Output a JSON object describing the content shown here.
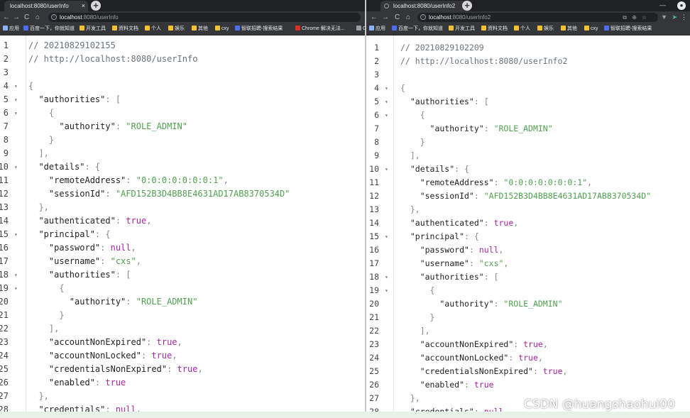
{
  "left": {
    "tab": {
      "title": "localhost:8080/userInfo",
      "close": "×"
    },
    "newtab": "+",
    "nav": {
      "back": "←",
      "forward": "→",
      "reload": "C",
      "home": "⌂"
    },
    "url": {
      "host": "localhost",
      "path": ":8080/userInfo"
    },
    "bookmarks": [
      {
        "label": "应用",
        "icon": "grid"
      },
      {
        "label": "百度一下，你就知道",
        "icon": "blue"
      },
      {
        "label": "开发工具",
        "icon": "folder"
      },
      {
        "label": "资料文档",
        "icon": "folder"
      },
      {
        "label": "个人",
        "icon": "folder"
      },
      {
        "label": "娱乐",
        "icon": "folder"
      },
      {
        "label": "其他",
        "icon": "folder"
      },
      {
        "label": "cxy",
        "icon": "folder"
      },
      {
        "label": "智联招聘-搜索结果",
        "icon": "blue"
      },
      {
        "label": "Chrome 解决无法...",
        "icon": "red"
      },
      {
        "label": "Oper",
        "icon": "gray"
      }
    ],
    "lines": [
      {
        "n": "1",
        "f": "",
        "t": [
          [
            "c",
            "// 20210829102155"
          ]
        ]
      },
      {
        "n": "2",
        "f": "",
        "t": [
          [
            "c",
            "// http://localhost:8080/userInfo"
          ]
        ]
      },
      {
        "n": "3",
        "f": "",
        "t": []
      },
      {
        "n": "4",
        "f": "▾",
        "t": [
          [
            "p",
            "{"
          ]
        ]
      },
      {
        "n": "5",
        "f": "▾",
        "t": [
          [
            "k",
            "  \"authorities\""
          ],
          [
            "p",
            ": ["
          ]
        ]
      },
      {
        "n": "6",
        "f": "▾",
        "t": [
          [
            "p",
            "    {"
          ]
        ]
      },
      {
        "n": "7",
        "f": "",
        "t": [
          [
            "k",
            "      \"authority\""
          ],
          [
            "p",
            ": "
          ],
          [
            "s",
            "\"ROLE_ADMIN\""
          ]
        ]
      },
      {
        "n": "8",
        "f": "",
        "t": [
          [
            "p",
            "    }"
          ]
        ]
      },
      {
        "n": "9",
        "f": "",
        "t": [
          [
            "p",
            "  ],"
          ]
        ]
      },
      {
        "n": "10",
        "f": "▾",
        "t": [
          [
            "k",
            "  \"details\""
          ],
          [
            "p",
            ": {"
          ]
        ]
      },
      {
        "n": "11",
        "f": "",
        "t": [
          [
            "k",
            "    \"remoteAddress\""
          ],
          [
            "p",
            ": "
          ],
          [
            "s",
            "\"0:0:0:0:0:0:0:1\""
          ],
          [
            "p",
            ","
          ]
        ]
      },
      {
        "n": "12",
        "f": "",
        "t": [
          [
            "k",
            "    \"sessionId\""
          ],
          [
            "p",
            ": "
          ],
          [
            "s",
            "\"AFD152B3D4BB8E4631AD17AB8370534D\""
          ]
        ]
      },
      {
        "n": "13",
        "f": "",
        "t": [
          [
            "p",
            "  },"
          ]
        ]
      },
      {
        "n": "14",
        "f": "",
        "t": [
          [
            "k",
            "  \"authenticated\""
          ],
          [
            "p",
            ": "
          ],
          [
            "b",
            "true"
          ],
          [
            "p",
            ","
          ]
        ]
      },
      {
        "n": "15",
        "f": "▾",
        "t": [
          [
            "k",
            "  \"principal\""
          ],
          [
            "p",
            ": {"
          ]
        ]
      },
      {
        "n": "16",
        "f": "",
        "t": [
          [
            "k",
            "    \"password\""
          ],
          [
            "p",
            ": "
          ],
          [
            "b",
            "null"
          ],
          [
            "p",
            ","
          ]
        ]
      },
      {
        "n": "17",
        "f": "",
        "t": [
          [
            "k",
            "    \"username\""
          ],
          [
            "p",
            ": "
          ],
          [
            "s",
            "\"cxs\""
          ],
          [
            "p",
            ","
          ]
        ]
      },
      {
        "n": "18",
        "f": "▾",
        "t": [
          [
            "k",
            "    \"authorities\""
          ],
          [
            "p",
            ": ["
          ]
        ]
      },
      {
        "n": "19",
        "f": "▾",
        "t": [
          [
            "p",
            "      {"
          ]
        ]
      },
      {
        "n": "20",
        "f": "",
        "t": [
          [
            "k",
            "        \"authority\""
          ],
          [
            "p",
            ": "
          ],
          [
            "s",
            "\"ROLE_ADMIN\""
          ]
        ]
      },
      {
        "n": "21",
        "f": "",
        "t": [
          [
            "p",
            "      }"
          ]
        ]
      },
      {
        "n": "22",
        "f": "",
        "t": [
          [
            "p",
            "    ],"
          ]
        ]
      },
      {
        "n": "23",
        "f": "",
        "t": [
          [
            "k",
            "    \"accountNonExpired\""
          ],
          [
            "p",
            ": "
          ],
          [
            "b",
            "true"
          ],
          [
            "p",
            ","
          ]
        ]
      },
      {
        "n": "24",
        "f": "",
        "t": [
          [
            "k",
            "    \"accountNonLocked\""
          ],
          [
            "p",
            ": "
          ],
          [
            "b",
            "true"
          ],
          [
            "p",
            ","
          ]
        ]
      },
      {
        "n": "25",
        "f": "",
        "t": [
          [
            "k",
            "    \"credentialsNonExpired\""
          ],
          [
            "p",
            ": "
          ],
          [
            "b",
            "true"
          ],
          [
            "p",
            ","
          ]
        ]
      },
      {
        "n": "26",
        "f": "",
        "t": [
          [
            "k",
            "    \"enabled\""
          ],
          [
            "p",
            ": "
          ],
          [
            "b",
            "true"
          ]
        ]
      },
      {
        "n": "27",
        "f": "",
        "t": [
          [
            "p",
            "  },"
          ]
        ]
      },
      {
        "n": "28",
        "f": "",
        "t": [
          [
            "k",
            "  \"credentials\""
          ],
          [
            "p",
            ": "
          ],
          [
            "b",
            "null"
          ],
          [
            "p",
            ","
          ]
        ]
      }
    ]
  },
  "right": {
    "tab": {
      "title": "localhost:8080/userInfo2",
      "close": "×"
    },
    "newtab": "+",
    "nav": {
      "back": "←",
      "forward": "→",
      "reload": "C",
      "home": "⌂"
    },
    "url": {
      "host": "localhost",
      "path": ":8080/userInfo2"
    },
    "bookmarks": [
      {
        "label": "应用",
        "icon": "grid"
      },
      {
        "label": "百度一下，你就知道",
        "icon": "blue"
      },
      {
        "label": "开发工具",
        "icon": "folder"
      },
      {
        "label": "资料文档",
        "icon": "folder"
      },
      {
        "label": "个人",
        "icon": "folder"
      },
      {
        "label": "娱乐",
        "icon": "folder"
      },
      {
        "label": "其他",
        "icon": "folder"
      },
      {
        "label": "cxy",
        "icon": "folder"
      },
      {
        "label": "智联招聘-搜索结果",
        "icon": "blue"
      }
    ],
    "lines": [
      {
        "n": "1",
        "f": "",
        "t": [
          [
            "c",
            "// 20210829102209"
          ]
        ]
      },
      {
        "n": "2",
        "f": "",
        "t": [
          [
            "c",
            "// http://localhost:8080/userInfo2"
          ]
        ]
      },
      {
        "n": "3",
        "f": "",
        "t": []
      },
      {
        "n": "4",
        "f": "▾",
        "t": [
          [
            "p",
            "{"
          ]
        ]
      },
      {
        "n": "5",
        "f": "▾",
        "t": [
          [
            "k",
            "  \"authorities\""
          ],
          [
            "p",
            ": ["
          ]
        ]
      },
      {
        "n": "6",
        "f": "▾",
        "t": [
          [
            "p",
            "    {"
          ]
        ]
      },
      {
        "n": "7",
        "f": "",
        "t": [
          [
            "k",
            "      \"authority\""
          ],
          [
            "p",
            ": "
          ],
          [
            "s",
            "\"ROLE_ADMIN\""
          ]
        ]
      },
      {
        "n": "8",
        "f": "",
        "t": [
          [
            "p",
            "    }"
          ]
        ]
      },
      {
        "n": "9",
        "f": "",
        "t": [
          [
            "p",
            "  ],"
          ]
        ]
      },
      {
        "n": "10",
        "f": "▾",
        "t": [
          [
            "k",
            "  \"details\""
          ],
          [
            "p",
            ": {"
          ]
        ]
      },
      {
        "n": "11",
        "f": "",
        "t": [
          [
            "k",
            "    \"remoteAddress\""
          ],
          [
            "p",
            ": "
          ],
          [
            "s",
            "\"0:0:0:0:0:0:0:1\""
          ],
          [
            "p",
            ","
          ]
        ]
      },
      {
        "n": "12",
        "f": "",
        "t": [
          [
            "k",
            "    \"sessionId\""
          ],
          [
            "p",
            ": "
          ],
          [
            "s",
            "\"AFD152B3D4BB8E4631AD17AB8370534D\""
          ]
        ]
      },
      {
        "n": "13",
        "f": "",
        "t": [
          [
            "p",
            "  },"
          ]
        ]
      },
      {
        "n": "14",
        "f": "",
        "t": [
          [
            "k",
            "  \"authenticated\""
          ],
          [
            "p",
            ": "
          ],
          [
            "b",
            "true"
          ],
          [
            "p",
            ","
          ]
        ]
      },
      {
        "n": "15",
        "f": "▾",
        "t": [
          [
            "k",
            "  \"principal\""
          ],
          [
            "p",
            ": {"
          ]
        ]
      },
      {
        "n": "16",
        "f": "",
        "t": [
          [
            "k",
            "    \"password\""
          ],
          [
            "p",
            ": "
          ],
          [
            "b",
            "null"
          ],
          [
            "p",
            ","
          ]
        ]
      },
      {
        "n": "17",
        "f": "",
        "t": [
          [
            "k",
            "    \"username\""
          ],
          [
            "p",
            ": "
          ],
          [
            "s",
            "\"cxs\""
          ],
          [
            "p",
            ","
          ]
        ]
      },
      {
        "n": "18",
        "f": "▾",
        "t": [
          [
            "k",
            "    \"authorities\""
          ],
          [
            "p",
            ": ["
          ]
        ]
      },
      {
        "n": "19",
        "f": "▾",
        "t": [
          [
            "p",
            "      {"
          ]
        ]
      },
      {
        "n": "20",
        "f": "",
        "t": [
          [
            "k",
            "        \"authority\""
          ],
          [
            "p",
            ": "
          ],
          [
            "s",
            "\"ROLE_ADMIN\""
          ]
        ]
      },
      {
        "n": "21",
        "f": "",
        "t": [
          [
            "p",
            "      }"
          ]
        ]
      },
      {
        "n": "22",
        "f": "",
        "t": [
          [
            "p",
            "    ],"
          ]
        ]
      },
      {
        "n": "23",
        "f": "",
        "t": [
          [
            "k",
            "    \"accountNonExpired\""
          ],
          [
            "p",
            ": "
          ],
          [
            "b",
            "true"
          ],
          [
            "p",
            ","
          ]
        ]
      },
      {
        "n": "24",
        "f": "",
        "t": [
          [
            "k",
            "    \"accountNonLocked\""
          ],
          [
            "p",
            ": "
          ],
          [
            "b",
            "true"
          ],
          [
            "p",
            ","
          ]
        ]
      },
      {
        "n": "25",
        "f": "",
        "t": [
          [
            "k",
            "    \"credentialsNonExpired\""
          ],
          [
            "p",
            ": "
          ],
          [
            "b",
            "true"
          ],
          [
            "p",
            ","
          ]
        ]
      },
      {
        "n": "26",
        "f": "",
        "t": [
          [
            "k",
            "    \"enabled\""
          ],
          [
            "p",
            ": "
          ],
          [
            "b",
            "true"
          ]
        ]
      },
      {
        "n": "27",
        "f": "",
        "t": [
          [
            "p",
            "  },"
          ]
        ]
      },
      {
        "n": "28",
        "f": "",
        "t": [
          [
            "k",
            "  \"credentials\""
          ],
          [
            "p",
            ": "
          ],
          [
            "b",
            "null"
          ]
        ]
      }
    ]
  },
  "watermark": "CSDN @huangshaohui00",
  "colors": {
    "key": "#222222",
    "string": "#50a14f",
    "boolean": "#a626a4",
    "comment": "#6a737d",
    "page_bg": "#e6f2e6"
  }
}
